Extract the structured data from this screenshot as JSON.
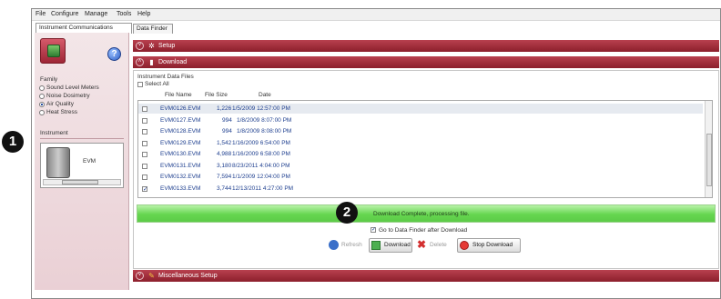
{
  "menu": [
    "File",
    "Configure",
    "Manage",
    "Tools",
    "Help"
  ],
  "tabs": [
    "Instrument Communications",
    "Data Finder"
  ],
  "left_panel": {
    "family_label": "Family",
    "families": [
      {
        "label": "Sound Level Meters",
        "selected": false
      },
      {
        "label": "Noise Dosimetry",
        "selected": false
      },
      {
        "label": "Air Quality",
        "selected": true
      },
      {
        "label": "Heat Stress",
        "selected": false
      }
    ],
    "instrument_label": "Instrument",
    "instrument_name": "EVM"
  },
  "sections": {
    "setup": "Setup",
    "download": "Download",
    "misc": "Miscellaneous Setup"
  },
  "download": {
    "list_title": "Instrument Data Files",
    "select_all": "Select All",
    "columns": [
      "File Name",
      "File Size",
      "Date"
    ],
    "files": [
      {
        "name": "EVM0126.EVM",
        "size": "1,226",
        "date": "1/5/2009 12:57:00 PM",
        "checked": false
      },
      {
        "name": "EVM0127.EVM",
        "size": "994",
        "date": "1/8/2009 8:07:00 PM",
        "checked": false
      },
      {
        "name": "EVM0128.EVM",
        "size": "994",
        "date": "1/8/2009 8:08:00 PM",
        "checked": false
      },
      {
        "name": "EVM0129.EVM",
        "size": "1,542",
        "date": "1/16/2009 6:54:00 PM",
        "checked": false
      },
      {
        "name": "EVM0130.EVM",
        "size": "4,988",
        "date": "1/16/2009 6:58:00 PM",
        "checked": false
      },
      {
        "name": "EVM0131.EVM",
        "size": "3,180",
        "date": "8/23/2011 4:04:00 PM",
        "checked": false
      },
      {
        "name": "EVM0132.EVM",
        "size": "7,594",
        "date": "1/1/2009 12:04:00 PM",
        "checked": false
      },
      {
        "name": "EVM0133.EVM",
        "size": "3,744",
        "date": "12/13/2011 4:27:00 PM",
        "checked": true
      }
    ],
    "status": "Download Complete, processing file.",
    "progress": 1.0,
    "goto_label": "Go to Data Finder after Download",
    "goto_checked": true,
    "buttons": {
      "refresh": "Refresh",
      "download": "Download",
      "delete": "Delete",
      "stop": "Stop Download"
    }
  },
  "callouts": [
    "1",
    "2"
  ],
  "colors": {
    "section_header": "#9c2a38",
    "left_panel": "#ecd6da",
    "progress": "#66d650",
    "file_text": "#1e3f8f"
  }
}
